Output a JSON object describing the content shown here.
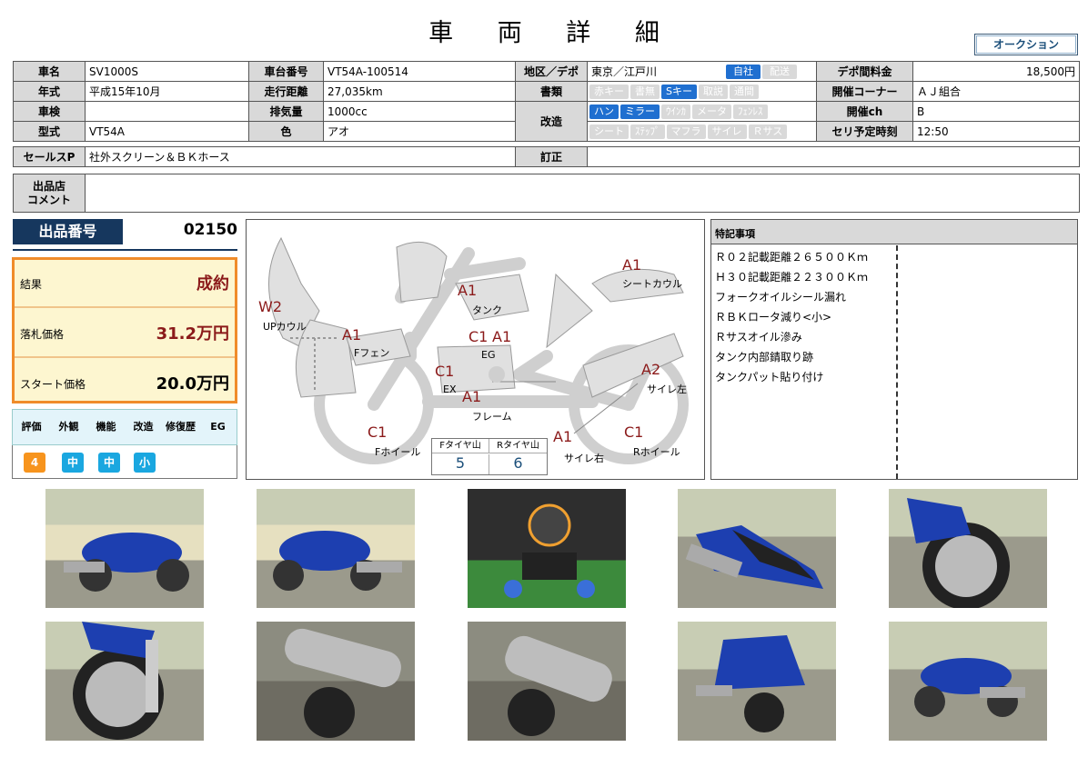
{
  "page_title": "車 両 詳 細",
  "auction_button": "オークション",
  "spec": {
    "name_label": "車名",
    "name": "SV1000S",
    "chassis_label": "車台番号",
    "chassis": "VT54A-100514",
    "region_label": "地区／デポ",
    "region": "東京／江戸川",
    "own": "自社",
    "delivery": "配送",
    "depot_fee_label": "デポ間料金",
    "depot_fee": "18,500円",
    "year_label": "年式",
    "year": "平成15年10月",
    "mileage_label": "走行距離",
    "mileage": "27,035km",
    "docs_label": "書類",
    "doc_chips": [
      "赤キー",
      "書無",
      "Sキー",
      "取説",
      "通間"
    ],
    "corner_label": "開催コーナー",
    "corner": "ＡＪ組合",
    "inspection_label": "車検",
    "inspection": "",
    "displacement_label": "排気量",
    "displacement": "1000cc",
    "mods_label": "改造",
    "mod_chips_1": [
      "ハン",
      "ミラー",
      "ｳｲﾝｶ",
      "メータ",
      "ﾌｪﾝﾚｽ"
    ],
    "mod_chips_2": [
      "シート",
      "ｽﾃｯﾌﾟ",
      "マフラ",
      "サイレ",
      "Ｒサス"
    ],
    "channel_label": "開催ch",
    "channel": "B",
    "model_label": "型式",
    "model": "VT54A",
    "color_label": "色",
    "color": "アオ",
    "time_label": "セリ予定時刻",
    "time": "12:50",
    "sales_label": "セールスP",
    "sales": "社外スクリーン＆ＢＫホース",
    "correction_label": "訂正",
    "correction": "",
    "comment_label_1": "出品店",
    "comment_label_2": "コメント",
    "comment": ""
  },
  "listing": {
    "label": "出品番号",
    "number": "02150"
  },
  "result": {
    "result_label": "結果",
    "result": "成約",
    "bid_label": "落札価格",
    "bid": "31.2万円",
    "start_label": "スタート価格",
    "start": "20.0万円"
  },
  "evaluation": {
    "headers": [
      "評価",
      "外観",
      "機能",
      "改造",
      "修復歴",
      "EG"
    ],
    "values": [
      "4",
      "中",
      "中",
      "小"
    ]
  },
  "diagram": {
    "labels": {
      "seat_cowl": "シートカウル",
      "tank": "タンク",
      "up_cowl": "UPカウル",
      "f_fender": "Fフェン",
      "eg": "EG",
      "ex": "EX",
      "frame": "フレーム",
      "silencer_l": "サイレ左",
      "silencer_r": "サイレ右",
      "f_wheel": "Fホイール",
      "r_wheel": "Rホイール"
    },
    "grades": {
      "seat_cowl": "A1",
      "tank": "A1",
      "up_cowl": "W2",
      "f_fender": "A1",
      "eg_c": "C1",
      "eg_a": "A1",
      "ex": "C1",
      "frame": "A1",
      "silencer_l": "A2",
      "silencer_r": "A1",
      "f_wheel": "C1",
      "r_wheel": "C1"
    },
    "tire": {
      "f_label": "Fタイヤ山",
      "r_label": "Rタイヤ山",
      "f": "5",
      "r": "6"
    }
  },
  "special": {
    "title": "特記事項",
    "items": [
      "Ｒ０２記載距離２６５００Ｋｍ",
      "Ｈ３０記載距離２２３００Ｋｍ",
      "フォークオイルシール漏れ",
      "ＲＢＫロータ減り<小>",
      "Ｒサスオイル滲み",
      "タンク内部錆取り跡",
      "タンクパット貼り付け"
    ]
  },
  "colors": {
    "header_bg": "#d9d9d9",
    "chip_on": "#1f6fd0",
    "navy": "#16375e",
    "orange": "#f08c2a",
    "grade_red": "#8b1a1a",
    "eval_cyan": "#1aa7e0",
    "eval_orange": "#f7941d"
  }
}
